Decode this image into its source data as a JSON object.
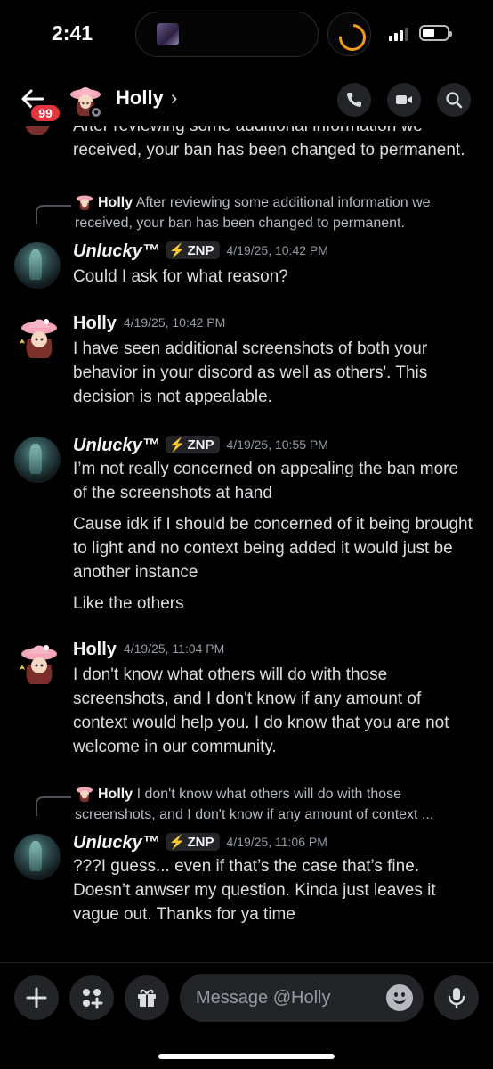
{
  "status_bar": {
    "time": "2:41"
  },
  "header": {
    "unread_badge": "99",
    "name": "Holly",
    "chevron": "›"
  },
  "messages": {
    "clipped_top": "After reviewing some additional information we received, your ban has been changed to permanent.",
    "reply1": {
      "author": "Holly",
      "text": "After reviewing some additional information we received, your ban has been changed to permanent."
    },
    "m1": {
      "author": "Unlucky™",
      "tag": "ZNP",
      "time": "4/19/25, 10:42 PM",
      "lines": [
        "Could I ask for what reason?"
      ]
    },
    "m2": {
      "author": "Holly",
      "time": "4/19/25, 10:42 PM",
      "lines": [
        "I have seen additional screenshots of both your behavior in your discord as well as others'. This decision is not appealable."
      ]
    },
    "m3": {
      "author": "Unlucky™",
      "tag": "ZNP",
      "time": "4/19/25, 10:55 PM",
      "lines": [
        "I’m not really concerned on appealing the ban more of the screenshots at hand",
        "Cause idk if I should be concerned of it being brought to light and no context being added it would just be another instance",
        "Like the others"
      ]
    },
    "m4": {
      "author": "Holly",
      "time": "4/19/25, 11:04 PM",
      "lines": [
        "I don't know what others will do with those screenshots, and I don't know if any amount of context would help you. I do know that you are not welcome in our community."
      ]
    },
    "reply2": {
      "author": "Holly",
      "text": "I don't know what others will do with those screenshots, and I don't know if any amount of context ..."
    },
    "m5": {
      "author": "Unlucky™",
      "tag": "ZNP",
      "time": "4/19/25, 11:06 PM",
      "lines": [
        "???I guess... even if that’s the case that’s fine. Doesn’t anwser my question. Kinda just leaves it vague out. Thanks for ya time"
      ]
    }
  },
  "composer": {
    "placeholder": "Message @Holly"
  },
  "colors": {
    "background": "#000000",
    "badge": "#e4343e",
    "bolt": "#4ea3ff",
    "timestamp": "#949ba4"
  }
}
